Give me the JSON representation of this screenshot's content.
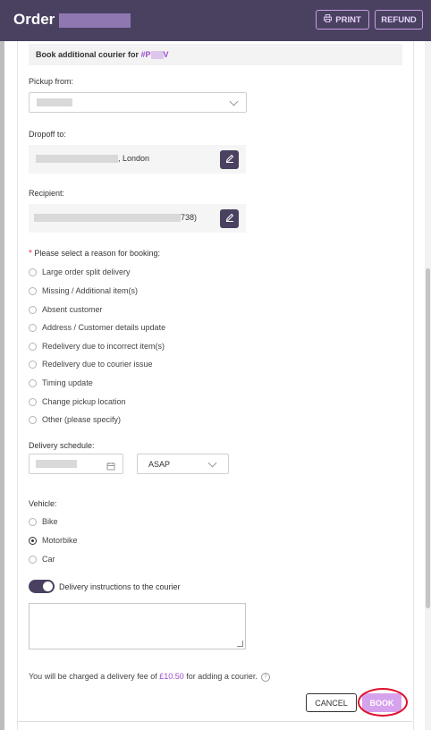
{
  "header": {
    "title": "Order",
    "print_label": "PRINT",
    "refund_label": "REFUND"
  },
  "booking": {
    "heading_prefix": "Book additional courier for ",
    "order_ref_start": "#P",
    "order_ref_end": "V"
  },
  "pickup": {
    "label": "Pickup from:",
    "selected": ""
  },
  "dropoff": {
    "label": "Dropoff to:",
    "address_suffix": ", London"
  },
  "recipient": {
    "label": "Recipient:",
    "value_suffix": "738)"
  },
  "reason": {
    "required_mark": "*",
    "label": "Please select a reason for booking:",
    "options": [
      "Large order split delivery",
      "Missing / Additional item(s)",
      "Absent customer",
      "Address / Customer details update",
      "Redelivery due to incorrect item(s)",
      "Redelivery due to courier issue",
      "Timing update",
      "Change pickup location",
      "Other (please specify)"
    ]
  },
  "schedule": {
    "label": "Delivery schedule:",
    "time_value": "ASAP"
  },
  "vehicle": {
    "label": "Vehicle:",
    "options": [
      "Bike",
      "Motorbike",
      "Car"
    ],
    "selected": "Motorbike"
  },
  "instructions": {
    "toggle_label": "Delivery instructions to the courier",
    "toggle_on": true,
    "value": ""
  },
  "fee": {
    "prefix": "You will be charged a delivery fee of ",
    "amount": "£10.50",
    "suffix": " for adding a courier."
  },
  "actions": {
    "cancel_label": "CANCEL",
    "book_label": "BOOK"
  },
  "colors": {
    "header_bg": "#4a4161",
    "accent": "#9b4dca",
    "book_button": "#d6a2ec",
    "highlight_circle": "#e0102b"
  }
}
